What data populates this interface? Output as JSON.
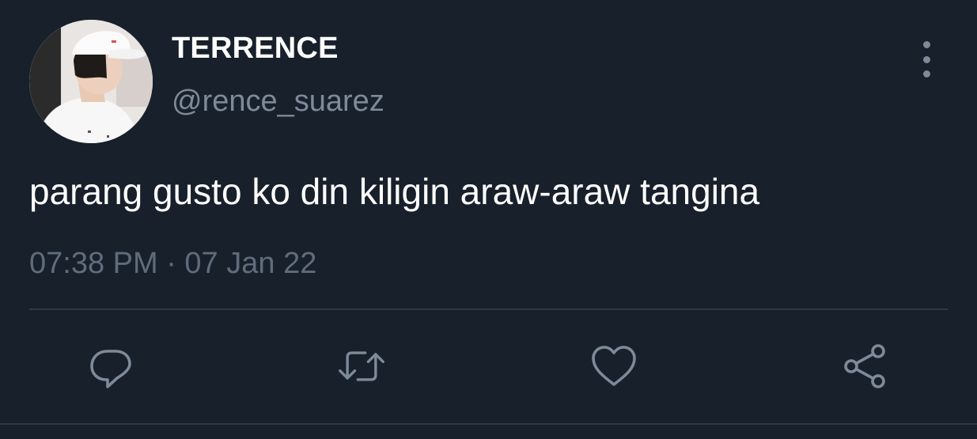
{
  "tweet": {
    "author": {
      "display_name": "TERRENCE",
      "handle": "@rence_suarez"
    },
    "text": "parang gusto ko din kiligin araw-araw tangina",
    "timestamp": "07:38 PM · 07 Jan 22"
  },
  "icons": {
    "more": "more-vertical-icon",
    "reply": "reply-icon",
    "retweet": "retweet-icon",
    "like": "heart-icon",
    "share": "share-icon"
  },
  "colors": {
    "background": "#18202b",
    "primary_text": "#ffffff",
    "secondary_text": "#7d8a99",
    "muted_text": "#5f6c7b",
    "divider": "#2f3945",
    "icon": "#7d8a99"
  }
}
